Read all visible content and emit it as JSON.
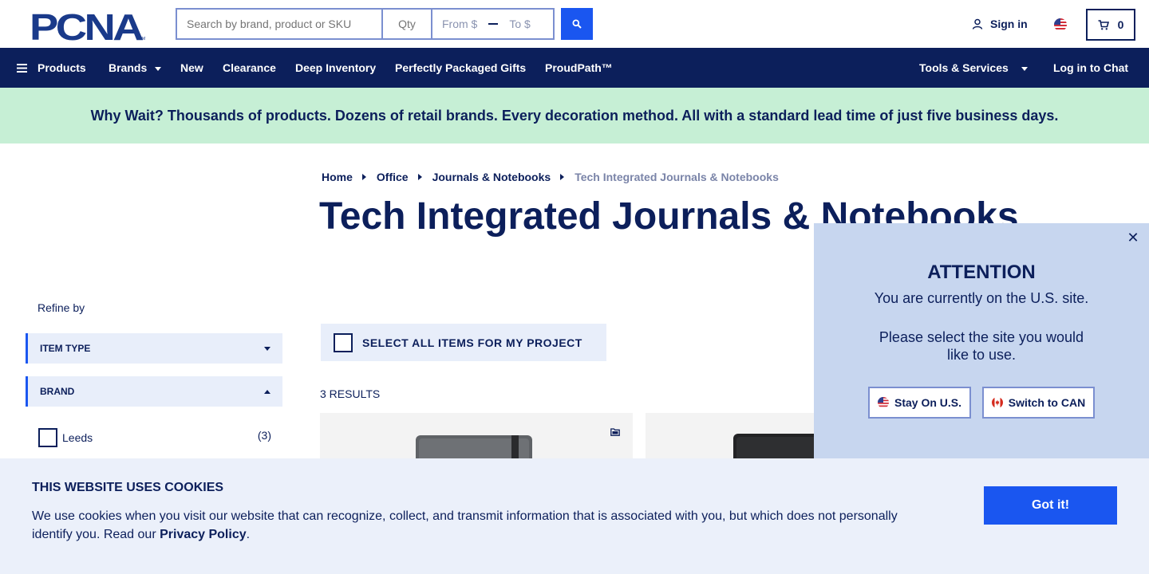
{
  "header": {
    "logo_text": "PCNA",
    "logo_tm": "TM",
    "search_placeholder": "Search by brand, product or SKU",
    "qty_placeholder": "Qty",
    "price_from": "From $",
    "price_to": "To $",
    "signin_label": "Sign in",
    "cart_count": "0"
  },
  "nav": {
    "products": "Products",
    "brands": "Brands",
    "new": "New",
    "clearance": "Clearance",
    "deep_inventory": "Deep Inventory",
    "gifts": "Perfectly Packaged Gifts",
    "proudpath": "ProudPath™",
    "tools": "Tools & Services",
    "chat": "Log in to Chat"
  },
  "banner": {
    "text": "Why Wait? Thousands of products. Dozens of retail brands. Every decoration method. All with a standard lead time of just five business days."
  },
  "breadcrumb": {
    "home": "Home",
    "office": "Office",
    "journals": "Journals & Notebooks",
    "current": "Tech Integrated Journals & Notebooks"
  },
  "page": {
    "title": "Tech Integrated Journals & Notebooks"
  },
  "sidebar": {
    "refine_label": "Refine by",
    "facets": [
      {
        "label": "ITEM TYPE"
      },
      {
        "label": "BRAND"
      }
    ],
    "brand_options": [
      {
        "label": "Leeds",
        "count": "(3)"
      }
    ]
  },
  "main": {
    "select_all_label": "SELECT ALL ITEMS FOR MY PROJECT",
    "results_label": "3 RESULTS"
  },
  "modal": {
    "title": "ATTENTION",
    "line1": "You are currently on the U.S. site.",
    "line2": "Please select the site you would like to use.",
    "stay_label": "Stay On U.S.",
    "switch_label": "Switch to CAN"
  },
  "cookie": {
    "title": "THIS WEBSITE USES COOKIES",
    "text": "We use cookies when you visit our website that can recognize, collect, and transmit information that is associated with you, but which does not personally identify you. Read our ",
    "link": "Privacy Policy",
    "end": ".",
    "button_label": "Got it!"
  },
  "colors": {
    "navy": "#0c1f5b",
    "accent_blue": "#1a56f0",
    "banner_green": "#c6efd5",
    "modal_bg": "#c7d6ef",
    "cookie_bg": "#ebf0fa"
  }
}
